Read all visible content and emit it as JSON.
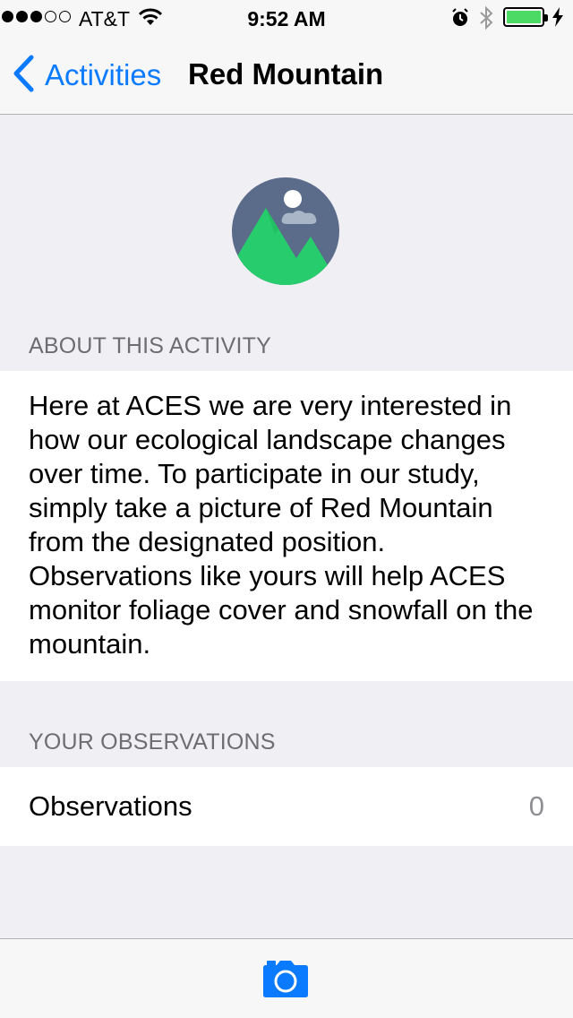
{
  "status_bar": {
    "carrier": "AT&T",
    "time": "9:52 AM",
    "signal_bars_filled": 3,
    "signal_bars_total": 5,
    "icons": [
      "wifi-icon",
      "alarm-icon",
      "bluetooth-icon",
      "battery-icon",
      "charging-icon"
    ]
  },
  "nav": {
    "back_label": "Activities",
    "title": "Red Mountain"
  },
  "about": {
    "header": "ABOUT THIS ACTIVITY",
    "text": "Here at ACES we are very interested in how our ecological landscape changes over time. To participate in our study, simply take a picture of Red Mountain from the designated position. Observations like yours will help ACES monitor foliage cover and snowfall on the mountain."
  },
  "observations": {
    "header": "YOUR OBSERVATIONS",
    "row_label": "Observations",
    "count": "0"
  },
  "toolbar": {
    "camera_icon": "camera-icon"
  },
  "colors": {
    "accent": "#0a7aff",
    "background": "#efeff4",
    "mountain_green": "#2ecc71",
    "sky": "#5b6c8a",
    "battery": "#4cd964"
  }
}
